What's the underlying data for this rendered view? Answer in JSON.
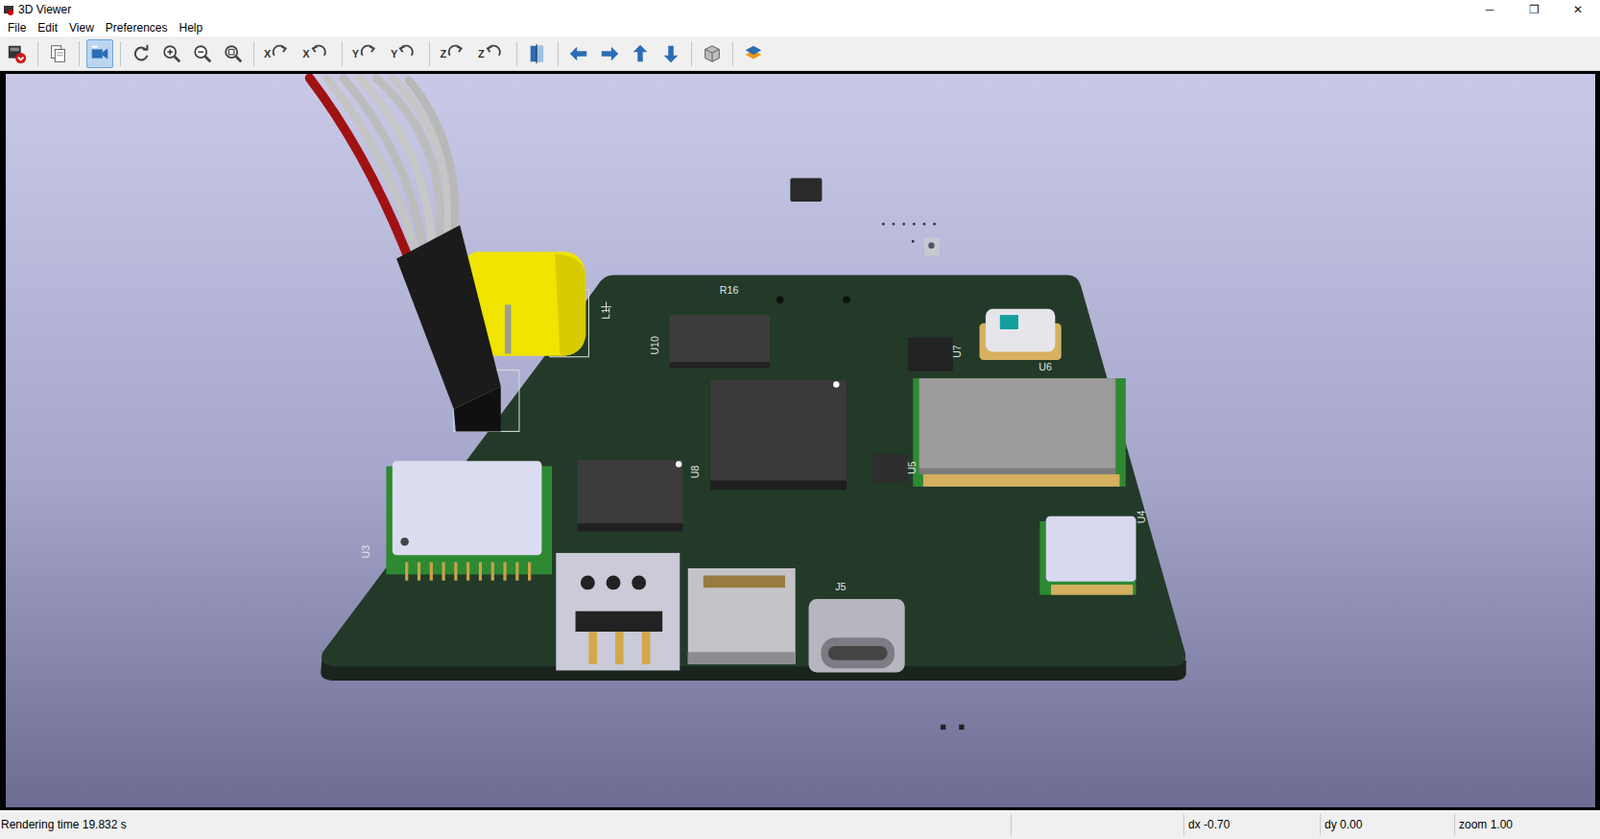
{
  "window": {
    "title": "3D Viewer",
    "controls": [
      "─",
      "❐",
      "✕"
    ]
  },
  "menu": [
    "File",
    "Edit",
    "View",
    "Preferences",
    "Help"
  ],
  "toolbar": [
    {
      "kind": "save",
      "selected": false
    },
    {
      "kind": "separator"
    },
    {
      "kind": "copy",
      "selected": false
    },
    {
      "kind": "separator"
    },
    {
      "kind": "render",
      "selected": true
    },
    {
      "kind": "separator"
    },
    {
      "kind": "reload",
      "selected": false
    },
    {
      "kind": "zoom-in",
      "selected": false
    },
    {
      "kind": "zoom-out",
      "selected": false
    },
    {
      "kind": "zoom-fit",
      "selected": false
    },
    {
      "kind": "separator"
    },
    {
      "kind": "rotate-cw",
      "label": "X",
      "selected": false
    },
    {
      "kind": "rotate-ccw",
      "label": "X",
      "selected": false
    },
    {
      "kind": "separator"
    },
    {
      "kind": "rotate-cw",
      "label": "Y",
      "selected": false
    },
    {
      "kind": "rotate-ccw",
      "label": "Y",
      "selected": false
    },
    {
      "kind": "separator"
    },
    {
      "kind": "rotate-cw",
      "label": "Z",
      "selected": false
    },
    {
      "kind": "rotate-ccw",
      "label": "Z",
      "selected": false
    },
    {
      "kind": "separator"
    },
    {
      "kind": "flip",
      "selected": false
    },
    {
      "kind": "separator"
    },
    {
      "kind": "left",
      "selected": false
    },
    {
      "kind": "right",
      "selected": false
    },
    {
      "kind": "up",
      "selected": false
    },
    {
      "kind": "down",
      "selected": false
    },
    {
      "kind": "separator"
    },
    {
      "kind": "ortho",
      "selected": false
    },
    {
      "kind": "separator"
    },
    {
      "kind": "layers",
      "selected": false
    }
  ],
  "board": {
    "labels": [
      "U10",
      "U8",
      "U3",
      "U7",
      "U6",
      "U5",
      "J5",
      "L1",
      "R16",
      "U4"
    ]
  },
  "status_bar": {
    "message": "Rendering time 19.832 s",
    "dx": "dx -0.70",
    "dy": "dy 0.00",
    "zoom": "zoom 1.00"
  }
}
